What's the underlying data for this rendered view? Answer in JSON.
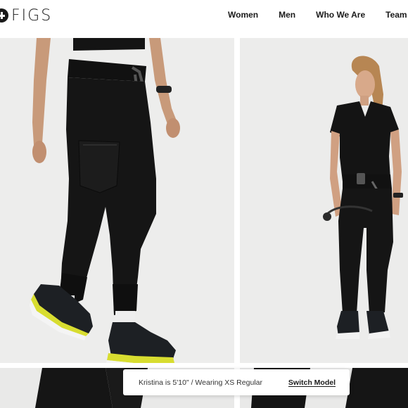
{
  "brand": {
    "name": "FIGS",
    "logo_icon": "figs-cross-logo"
  },
  "nav": {
    "items": [
      {
        "label": "Women"
      },
      {
        "label": "Men"
      },
      {
        "label": "Who We Are"
      },
      {
        "label": "Team"
      }
    ]
  },
  "gallery": {
    "images": [
      {
        "description_icon": "jogger-pants-closeup-image"
      },
      {
        "description_icon": "full-body-model-image"
      },
      {
        "description_icon": "pants-detail-image"
      },
      {
        "description_icon": "pants-back-detail-image"
      }
    ]
  },
  "model_toast": {
    "text": "Kristina is 5'10\" / Wearing XS Regular",
    "button_label": "Switch Model"
  },
  "colors": {
    "background": "#ffffff",
    "tile_background": "#ededec",
    "scrubs": "#141414",
    "text": "#1a1a1a"
  }
}
